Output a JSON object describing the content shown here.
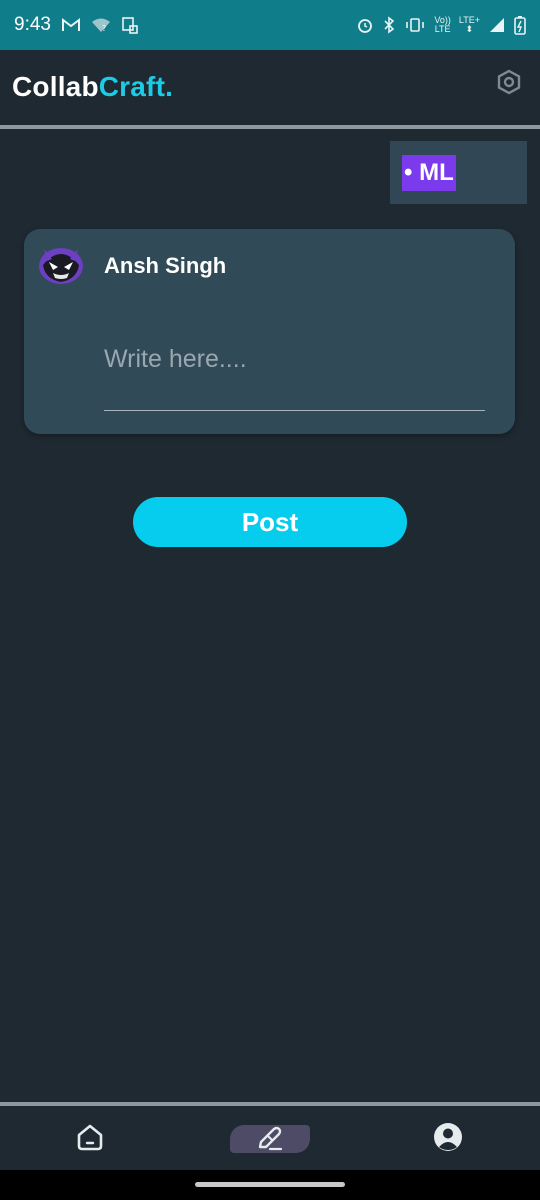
{
  "status_bar": {
    "time": "9:43",
    "volte": "Vo))",
    "lte_small": "LTE",
    "lte_plus": "LTE+"
  },
  "app_bar": {
    "brand_part1": "Collab",
    "brand_part2": "Craft.",
    "brand_accent_color": "#1ccbe6"
  },
  "tag": {
    "label": "• ML",
    "chip_color": "#7c3aed"
  },
  "compose": {
    "author_name": "Ansh Singh",
    "input_value": "",
    "input_placeholder": "Write here...."
  },
  "actions": {
    "post_label": "Post",
    "post_color": "#06cdee"
  },
  "bottom_nav": {
    "items": [
      {
        "icon": "home-icon",
        "active": false
      },
      {
        "icon": "create-post-icon",
        "active": true
      },
      {
        "icon": "profile-icon",
        "active": false
      }
    ]
  }
}
